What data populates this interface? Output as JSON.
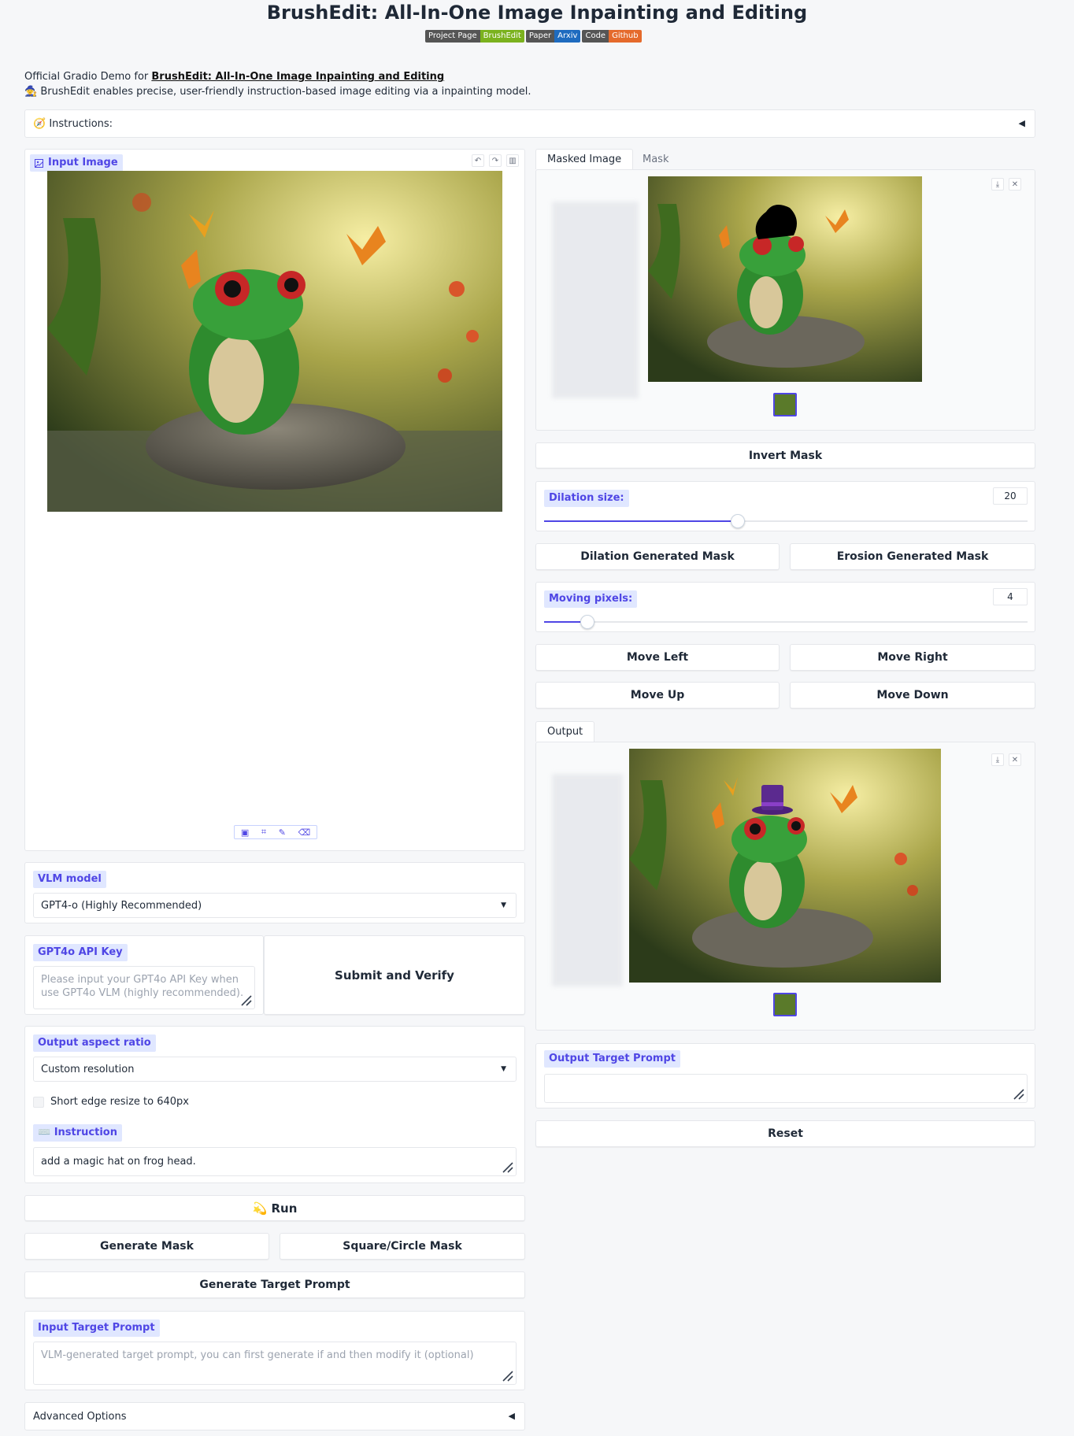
{
  "header": {
    "title": "BrushEdit: All-In-One Image Inpainting and Editing",
    "badges": [
      {
        "left": "Project Page",
        "right": "BrushEdit",
        "color": "#7bb21e"
      },
      {
        "left": "Paper",
        "right": "Arxiv",
        "color": "#1e6bbf"
      },
      {
        "left": "Code",
        "right": "Github",
        "color": "#e56a2c"
      }
    ],
    "intro_prefix": "Official Gradio Demo for ",
    "intro_link": "BrushEdit: All-In-One Image Inpainting and Editing",
    "intro_line2": "🧙 BrushEdit enables precise, user-friendly instruction-based image editing via a inpainting model."
  },
  "instructions": {
    "label": "🧭 Instructions:",
    "arrow": "◀"
  },
  "input_image": {
    "label": "Input Image"
  },
  "vlm": {
    "label": "VLM model",
    "value": "GPT4-o (Highly Recommended)"
  },
  "api_key": {
    "label": "GPT4o API Key",
    "placeholder": "Please input your GPT4o API Key when use GPT4o VLM (highly recommended).",
    "submit": "Submit and Verify"
  },
  "aspect": {
    "label": "Output aspect ratio",
    "value": "Custom resolution"
  },
  "resize_checkbox": {
    "label": "Short edge resize to 640px",
    "checked": false
  },
  "instruction": {
    "label": "⌨️ Instruction",
    "value": "add a magic hat on frog head."
  },
  "buttons": {
    "run": "💫 Run",
    "generate_mask": "Generate Mask",
    "square_mask": "Square/Circle Mask",
    "generate_prompt": "Generate Target Prompt",
    "invert_mask": "Invert Mask",
    "dilation_mask": "Dilation Generated Mask",
    "erosion_mask": "Erosion Generated Mask",
    "move_left": "Move Left",
    "move_right": "Move Right",
    "move_up": "Move Up",
    "move_down": "Move Down",
    "reset": "Reset"
  },
  "input_prompt": {
    "label": "Input Target Prompt",
    "placeholder": "VLM-generated target prompt, you can first generate if and then modify it (optional)"
  },
  "advanced": {
    "label": "Advanced Options",
    "arrow": "◀"
  },
  "mask_tabs": [
    "Masked Image",
    "Mask"
  ],
  "dilation": {
    "label": "Dilation size:",
    "value": "20",
    "fraction": 0.4
  },
  "moving": {
    "label": "Moving pixels:",
    "value": "4",
    "fraction": 0.09
  },
  "output_tab": "Output",
  "output_prompt": {
    "label": "Output Target Prompt",
    "value": ""
  },
  "colors": {
    "accent": "#4f46e5",
    "label_bg": "#e0e7ff"
  }
}
